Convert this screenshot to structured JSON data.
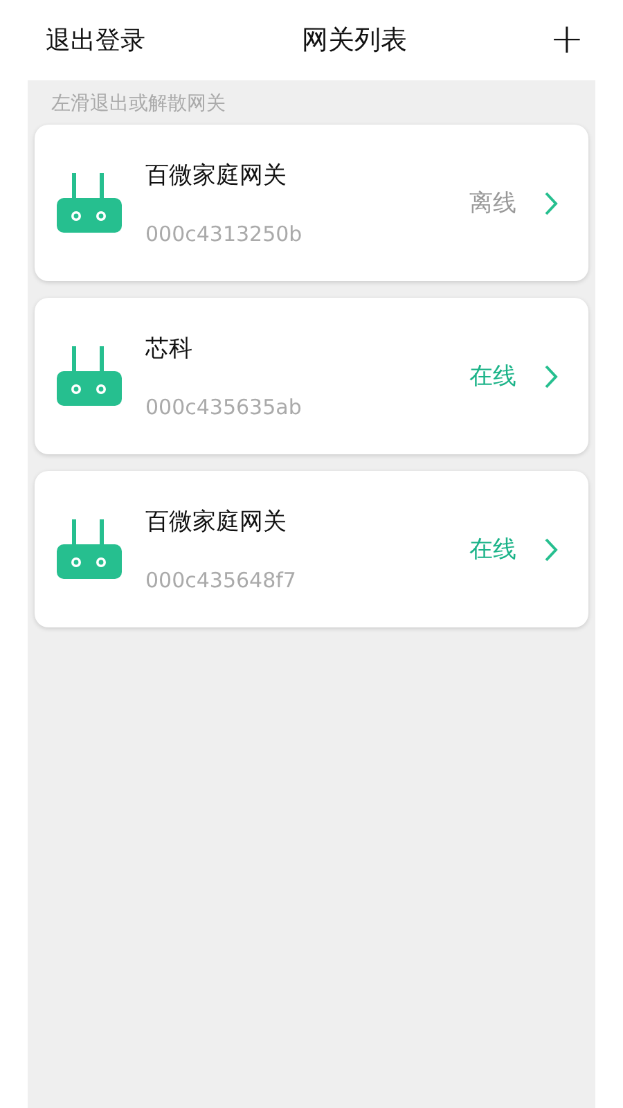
{
  "header": {
    "logout": "退出登录",
    "title": "网关列表",
    "add": "+"
  },
  "hint": "左滑退出或解散网关",
  "gateways": [
    {
      "name": "百微家庭网关",
      "id": "000c4313250b",
      "status": "离线",
      "online": false
    },
    {
      "name": "芯科",
      "id": "000c435635ab",
      "status": "在线",
      "online": true
    },
    {
      "name": "百微家庭网关",
      "id": "000c435648f7",
      "status": "在线",
      "online": true
    }
  ]
}
